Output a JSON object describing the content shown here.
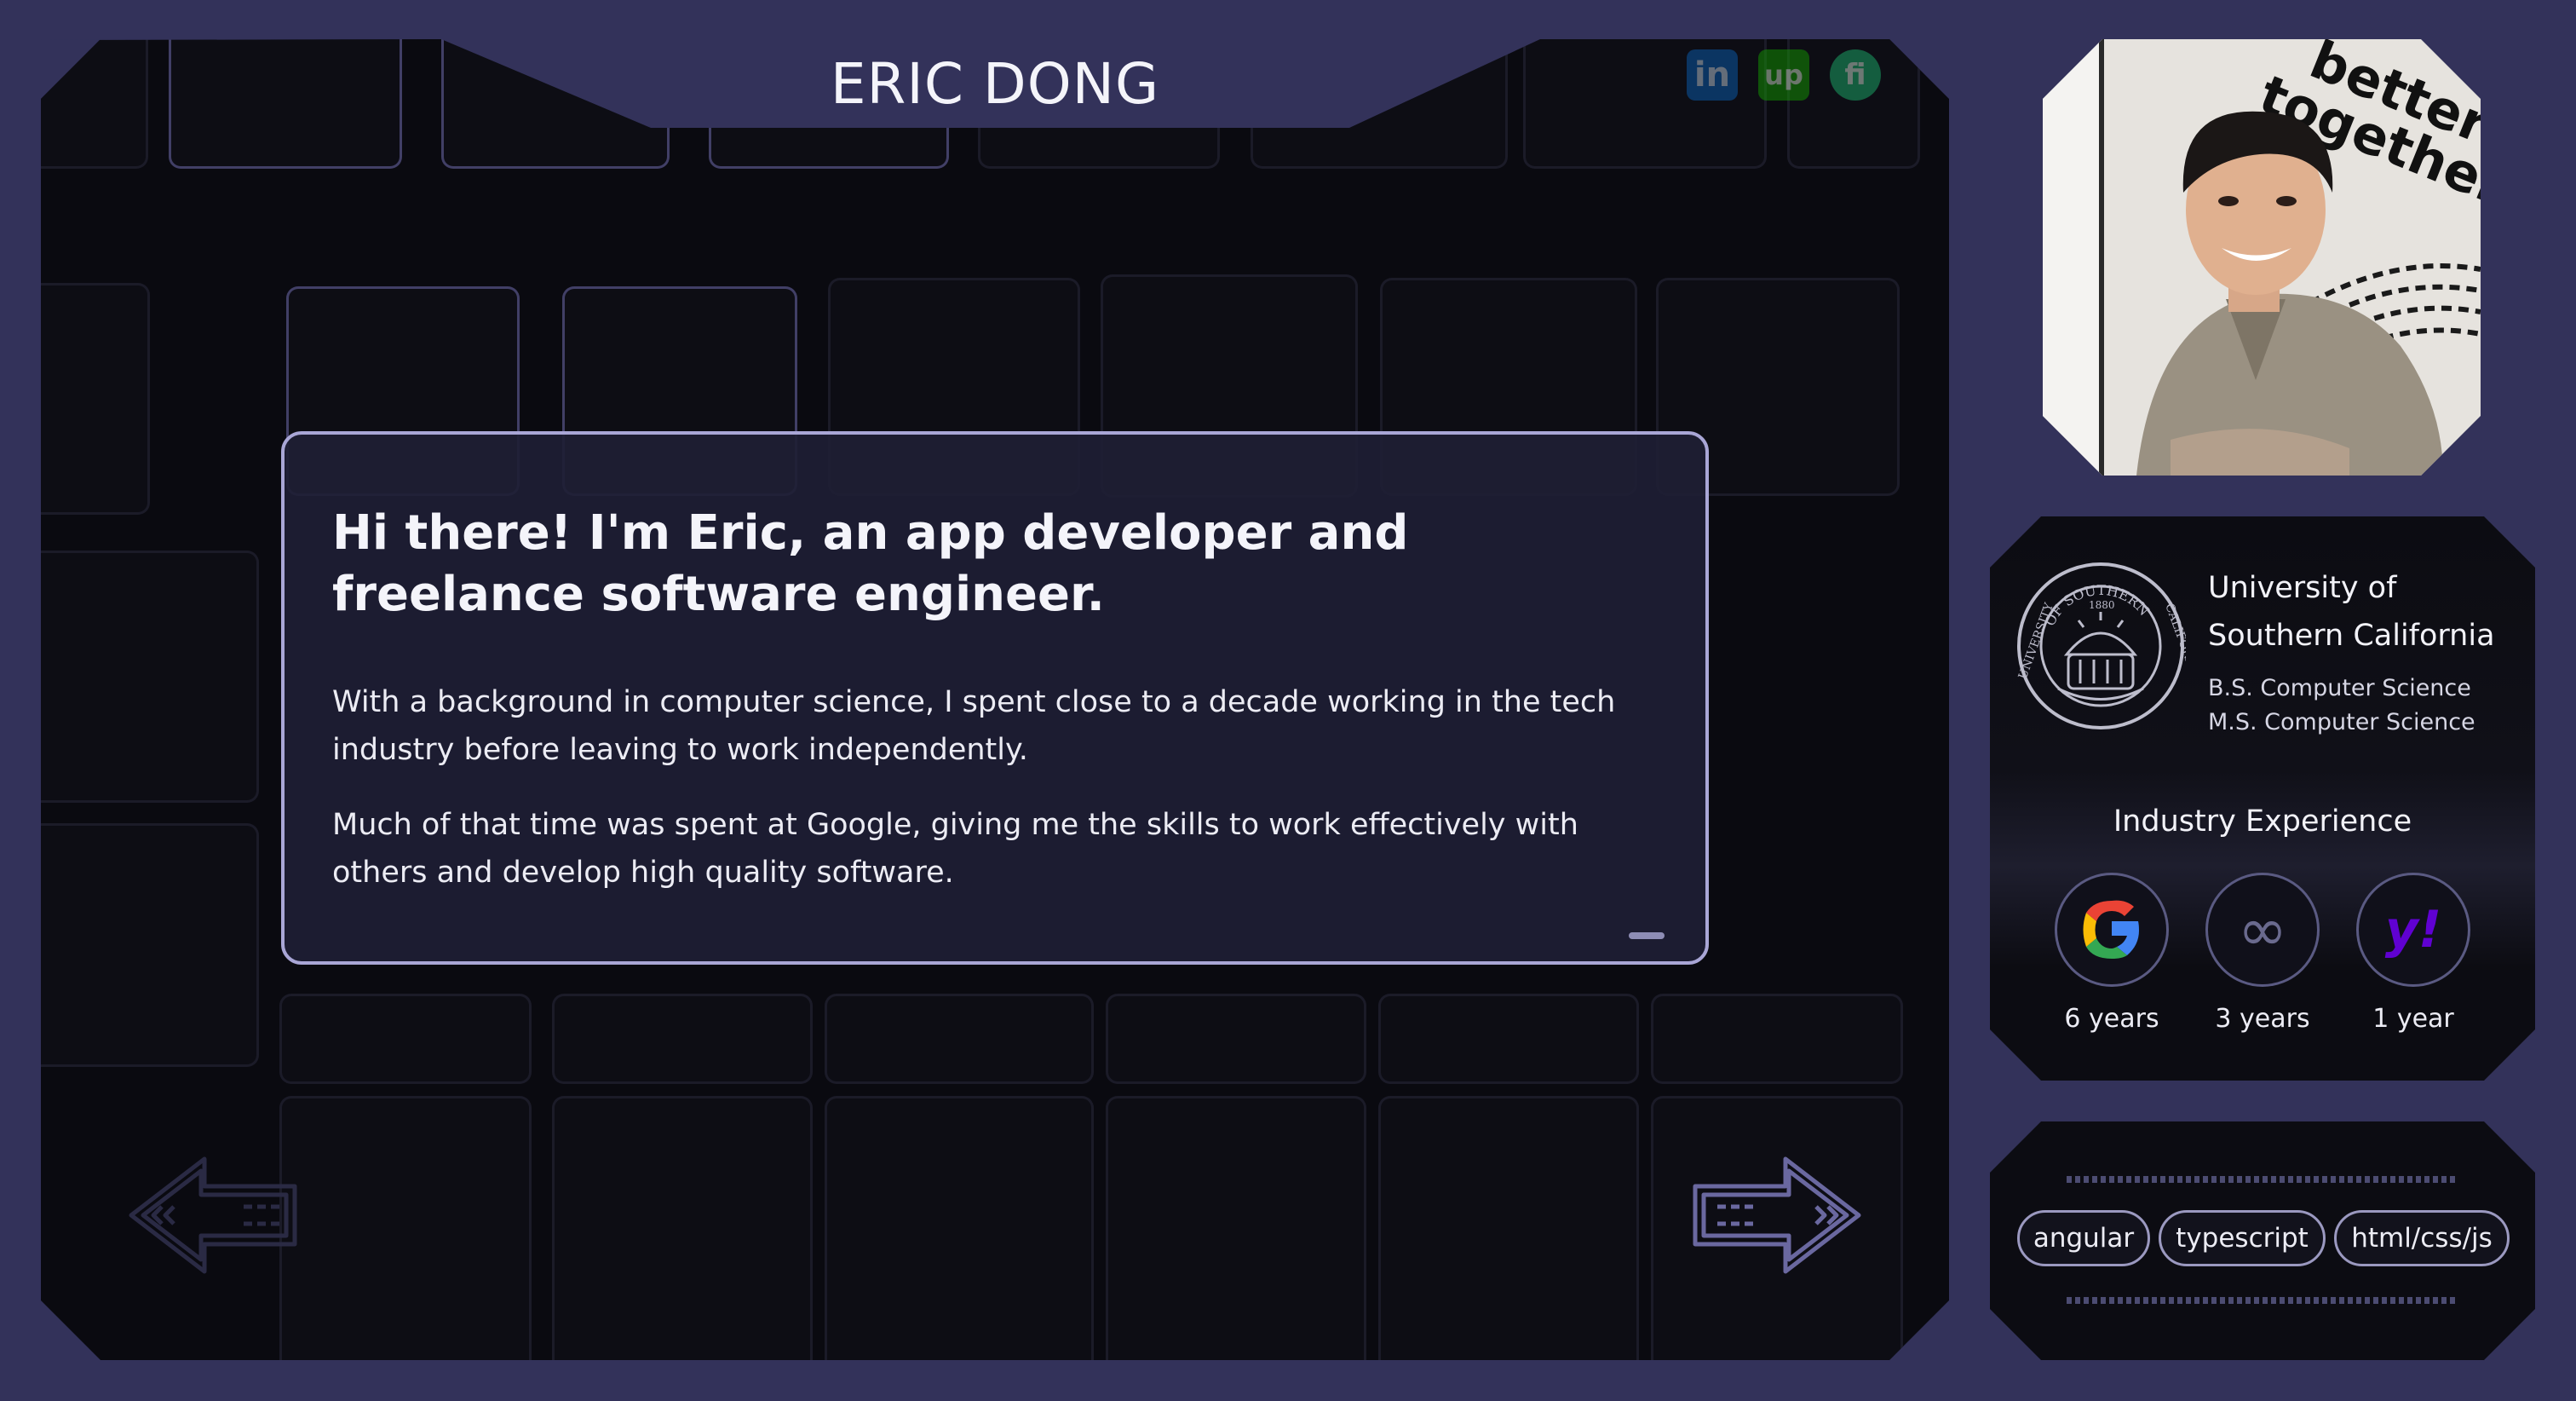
{
  "header": {
    "title": "ERIC DONG",
    "socials": [
      {
        "name": "linkedin",
        "glyph": "in"
      },
      {
        "name": "upwork",
        "glyph": "up"
      },
      {
        "name": "fiverr",
        "glyph": "fi"
      }
    ]
  },
  "intro": {
    "heading": "Hi there! I'm Eric, an app developer and freelance software engineer.",
    "paragraph_1": "With a background in computer science, I spent close to a decade working in the tech industry before leaving to work independently.",
    "paragraph_2": "Much of that time was spent at Google, giving me the skills to work effectively with others and develop high quality software."
  },
  "photo": {
    "sign_text_1": "better",
    "sign_text_2": "together"
  },
  "education": {
    "seal_top_text": "OF SOUTHERN",
    "seal_left_text": "UNIVERSITY",
    "seal_right_text": "CALIFORNIA",
    "seal_year": "1880",
    "university_line_1": "University of",
    "university_line_2": "Southern California",
    "degree_1": "B.S. Computer Science",
    "degree_2": "M.S. Computer Science"
  },
  "industry": {
    "title": "Industry Experience",
    "companies": [
      {
        "icon": "google-logo",
        "glyph": "G",
        "years": "6 years"
      },
      {
        "icon": "infinity-logo",
        "glyph": "∞",
        "years": "3 years"
      },
      {
        "icon": "yahoo-logo",
        "glyph": "y!",
        "years": "1 year"
      }
    ]
  },
  "skills": {
    "chips": [
      "angular",
      "typescript",
      "html/css/js"
    ]
  },
  "colors": {
    "page_background": "#33325a",
    "panel_background": "#0a0a10",
    "card_border": "#a9a6d6",
    "linkedin": "#0a66c2",
    "upwork": "#14a800",
    "fiverr": "#1dbf73",
    "yahoo": "#6001d2"
  }
}
